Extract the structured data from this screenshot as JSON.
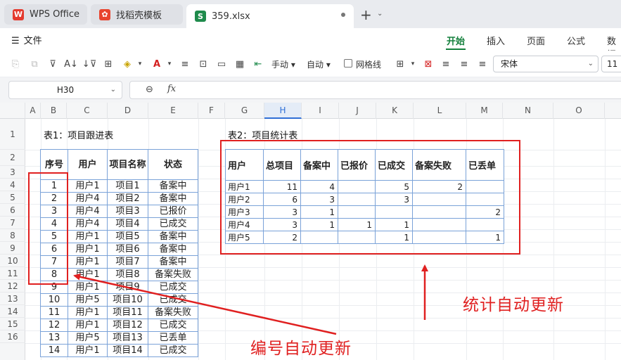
{
  "tabs": [
    {
      "label": "WPS Office",
      "icon": "wps-logo-icon"
    },
    {
      "label": "找稻壳模板",
      "icon": "docer-icon"
    },
    {
      "label": "359.xlsx",
      "icon": "spreadsheet-icon",
      "icon_letter": "S"
    }
  ],
  "menu": {
    "file_label": "文件",
    "ribbon_tabs": [
      "开始",
      "插入",
      "页面",
      "公式",
      "数据"
    ]
  },
  "toolbar": {
    "handheld_label": "手动",
    "auto_label": "自动",
    "gridlines_label": "网格线",
    "font_name": "宋体",
    "font_size": "11"
  },
  "formula_bar": {
    "name_box": "H30",
    "fx_label": "fx",
    "formula": ""
  },
  "sheet": {
    "columns": [
      "A",
      "B",
      "C",
      "D",
      "E",
      "F",
      "G",
      "H",
      "I",
      "J",
      "K",
      "L",
      "M",
      "N",
      "O"
    ],
    "rows": [
      "1",
      "2",
      "3",
      "4",
      "5",
      "6",
      "7",
      "8",
      "9",
      "10",
      "11",
      "12",
      "13",
      "14",
      "15",
      "16"
    ],
    "selected_column": "H"
  },
  "table1": {
    "title": "表1：项目跟进表",
    "headers": [
      "序号",
      "用户",
      "项目名称",
      "状态"
    ],
    "rows": [
      [
        "1",
        "用户1",
        "项目1",
        "备案中"
      ],
      [
        "2",
        "用户4",
        "项目2",
        "备案中"
      ],
      [
        "3",
        "用户4",
        "项目3",
        "已报价"
      ],
      [
        "4",
        "用户4",
        "项目4",
        "已成交"
      ],
      [
        "5",
        "用户1",
        "项目5",
        "备案中"
      ],
      [
        "6",
        "用户1",
        "项目6",
        "备案中"
      ],
      [
        "7",
        "用户1",
        "项目7",
        "备案中"
      ],
      [
        "8",
        "用户1",
        "项目8",
        "备案失败"
      ],
      [
        "9",
        "用户1",
        "项目9",
        "已成交"
      ],
      [
        "10",
        "用户5",
        "项目10",
        "已成交"
      ],
      [
        "11",
        "用户1",
        "项目11",
        "备案失败"
      ],
      [
        "12",
        "用户1",
        "项目12",
        "已成交"
      ],
      [
        "13",
        "用户5",
        "项目13",
        "已丢单"
      ],
      [
        "14",
        "用户1",
        "项目14",
        "已成交"
      ]
    ]
  },
  "table2": {
    "title": "表2：项目统计表",
    "headers": [
      "用户",
      "总项目",
      "备案中",
      "已报价",
      "已成交",
      "备案失败",
      "已丢单"
    ],
    "rows": [
      [
        "用户1",
        "11",
        "4",
        "",
        "5",
        "2",
        ""
      ],
      [
        "用户2",
        "6",
        "3",
        "",
        "3",
        "",
        ""
      ],
      [
        "用户3",
        "3",
        "1",
        "",
        "",
        "",
        "2"
      ],
      [
        "用户4",
        "3",
        "1",
        "1",
        "1",
        "",
        ""
      ],
      [
        "用户5",
        "2",
        "",
        "",
        "1",
        "",
        "1"
      ]
    ]
  },
  "annotations": {
    "auto_number": "编号自动更新",
    "auto_stats": "统计自动更新",
    "color": "#e02020"
  },
  "colors": {
    "accent": "#15803d",
    "table_border": "#7aa2d8"
  }
}
